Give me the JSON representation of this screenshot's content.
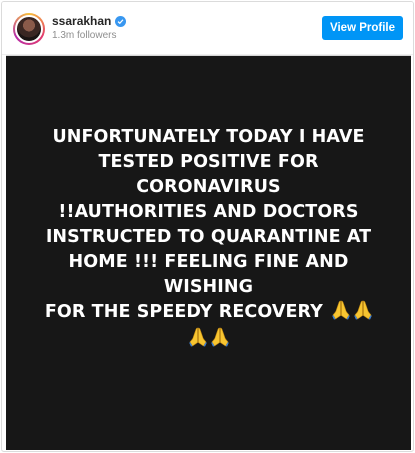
{
  "header": {
    "username": "ssarakhan",
    "followers": "1.3m followers",
    "view_profile_label": "View Profile"
  },
  "post": {
    "lines": [
      "UNFORTUNATELY TODAY I HAVE",
      "TESTED POSITIVE FOR",
      "CORONAVIRUS",
      "!!AUTHORITIES AND DOCTORS",
      "INSTRUCTED TO QUARANTINE AT",
      "HOME !!! FEELING FINE AND WISHING",
      "FOR THE SPEEDY RECOVERY"
    ],
    "emoji": "folded-hands",
    "emoji_color": "#f7c531",
    "background": "#171717"
  },
  "colors": {
    "button": "#0095f6",
    "verified": "#3897f0"
  }
}
